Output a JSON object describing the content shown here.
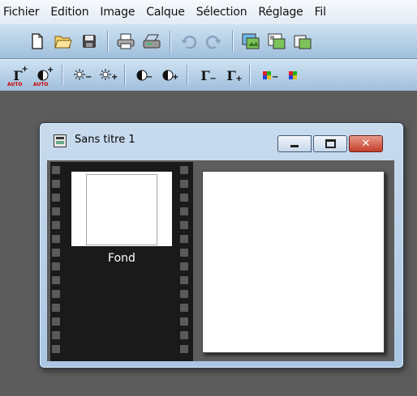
{
  "menu": [
    "Fichier",
    "Edition",
    "Image",
    "Calque",
    "Sélection",
    "Réglage",
    "Fil"
  ],
  "toolbar1": [
    "new-icon",
    "open-icon",
    "save-icon",
    "print-icon",
    "scan-icon",
    "undo-icon",
    "redo-icon",
    "layer-icon",
    "copy-image-icon",
    "paste-image-icon"
  ],
  "toolbar2": [
    "gamma-auto-icon",
    "contrast-auto-icon",
    "brightness-minus-icon",
    "brightness-plus-icon",
    "contrast-minus-icon",
    "contrast-plus-icon",
    "gamma-minus-icon",
    "gamma-plus-icon",
    "color-minus-icon",
    "color-plus-icon"
  ],
  "auto_badge": "AUTO",
  "document": {
    "title": "Sans titre 1",
    "layer_name": "Fond"
  }
}
